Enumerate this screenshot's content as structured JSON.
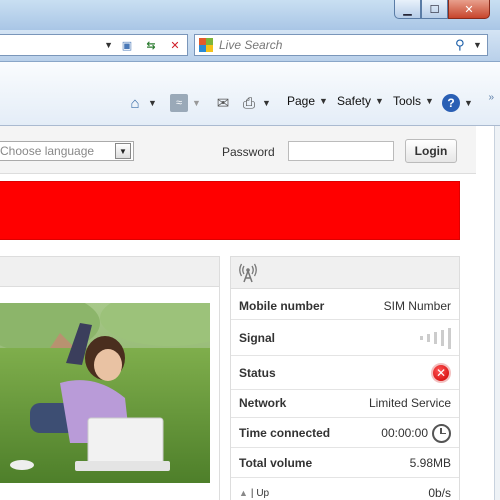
{
  "browser": {
    "search_placeholder": "Live Search",
    "commands": {
      "page": "Page",
      "safety": "Safety",
      "tools": "Tools"
    }
  },
  "header": {
    "language_select_value": "Choose language",
    "password_label": "Password",
    "login_button": "Login"
  },
  "status_panel": {
    "rows": {
      "mobile_number": {
        "label": "Mobile number",
        "value": "SIM Number"
      },
      "signal": {
        "label": "Signal",
        "level": 0
      },
      "status": {
        "label": "Status"
      },
      "network": {
        "label": "Network",
        "value": "Limited Service"
      },
      "time_connected": {
        "label": "Time connected",
        "value": "00:00:00"
      },
      "total_volume": {
        "label": "Total volume",
        "value": "5.98MB"
      },
      "up": {
        "label": "Up",
        "value": "0b/s"
      }
    }
  },
  "colors": {
    "banner": "#ff0000",
    "status_error": "#cc0000"
  },
  "icons": {
    "home": "home-icon",
    "feeds": "rss-icon",
    "mail": "mail-icon",
    "print": "printer-icon",
    "help": "help-icon",
    "antenna": "antenna-icon",
    "status": "error-x-icon",
    "time": "clock-icon"
  }
}
